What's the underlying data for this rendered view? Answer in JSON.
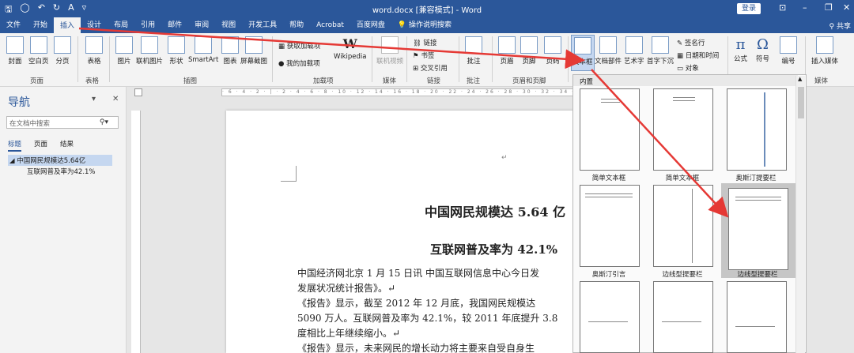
{
  "window": {
    "title": "word.docx [兼容模式] - Word",
    "login_label": "登录",
    "share_label": "共享"
  },
  "tabs": [
    "文件",
    "开始",
    "插入",
    "设计",
    "布局",
    "引用",
    "邮件",
    "审阅",
    "视图",
    "开发工具",
    "帮助",
    "Acrobat",
    "百度网盘",
    "操作说明搜索"
  ],
  "active_tab": "插入",
  "ribbon": {
    "buttons": {
      "cover": "封面",
      "blank": "空白页",
      "break": "分页",
      "table": "表格",
      "picture": "图片",
      "online_picture": "联机图片",
      "shapes": "形状",
      "smartart": "SmartArt",
      "chart": "图表",
      "screenshot": "屏幕截图",
      "get_addins": "获取加载项",
      "my_addins": "我的加载项",
      "wikipedia": "Wikipedia",
      "online_video": "联机视频",
      "link": "链接",
      "bookmark": "书签",
      "crossref": "交叉引用",
      "comment": "批注",
      "header": "页眉",
      "footer": "页脚",
      "page_number": "页码",
      "textbox": "文本框",
      "quick_parts": "文档部件",
      "wordart": "艺术字",
      "dropcap": "首字下沉",
      "signature": "签名行",
      "datetime": "日期和时间",
      "object": "对象",
      "equation": "公式",
      "symbol": "符号",
      "numbering": "编号",
      "embed_media": "插入媒体"
    },
    "groups": {
      "pages": "页面",
      "tables": "表格",
      "illustrations": "插图",
      "addins": "加载项",
      "media": "媒体",
      "links": "链接",
      "comments": "批注",
      "header_footer": "页眉和页脚",
      "media2": "媒体"
    }
  },
  "nav": {
    "title": "导航",
    "search_placeholder": "在文档中搜索",
    "tabs": [
      "标题",
      "页面",
      "结果"
    ],
    "items": [
      "中国网民规模达5.64亿",
      "互联网普及率为42.1%"
    ]
  },
  "document": {
    "heading1": "中国网民规模达 5.64 亿",
    "heading2": "互联网普及率为 42.1%",
    "lines": [
      "中国经济网北京 1 月 15 日讯 中国互联网信息中心今日发",
      "发展状况统计报告》。↵",
      "《报告》显示，截至 2012 年 12 月底，我国网民规模达",
      "5090 万人。互联网普及率为 42.1%，较 2011 年底提升 3.8",
      "度相比上年继续缩小。↵",
      "《报告》显示，未来网民的增长动力将主要来自受自身生"
    ]
  },
  "gallery": {
    "section": "内置",
    "items": [
      "简单文本框",
      "简单文本框",
      "奥斯汀提要栏",
      "奥斯汀引言",
      "边线型提要栏",
      "边线型提要栏",
      "",
      "",
      ""
    ]
  },
  "colors": {
    "accent": "#2b579a",
    "arrow": "#e53935"
  }
}
